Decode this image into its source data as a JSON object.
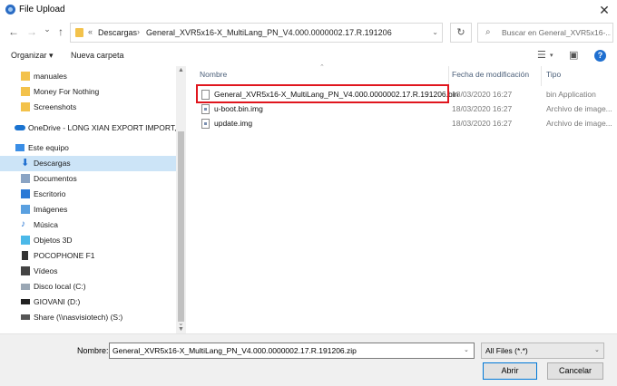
{
  "window": {
    "title": "File Upload",
    "close_glyph": "✕"
  },
  "nav": {
    "back": "←",
    "forward": "→",
    "recent": "⌄",
    "up": "↑"
  },
  "address": {
    "prefix": "«",
    "crumbs": [
      "Descargas",
      "General_XVR5x16-X_MultiLang_PN_V4.000.0000002.17.R.191206"
    ],
    "separator": "›"
  },
  "search": {
    "placeholder": "Buscar en General_XVR5x16-..."
  },
  "toolbar": {
    "organize": "Organizar ▾",
    "new_folder": "Nueva carpeta"
  },
  "sidebar": {
    "items": [
      {
        "label": "manuales",
        "icon": "folder-icon"
      },
      {
        "label": "Money For Nothing",
        "icon": "folder-icon"
      },
      {
        "label": "Screenshots",
        "icon": "folder-icon"
      },
      {
        "label": "OneDrive - LONG XIAN EXPORT IMPORT, SI",
        "icon": "onedrive-icon"
      },
      {
        "label": "Este equipo",
        "icon": "computer-icon"
      },
      {
        "label": "Descargas",
        "icon": "downloads-icon",
        "selected": true
      },
      {
        "label": "Documentos",
        "icon": "documents-icon"
      },
      {
        "label": "Escritorio",
        "icon": "desktop-icon"
      },
      {
        "label": "Imágenes",
        "icon": "pictures-icon"
      },
      {
        "label": "Música",
        "icon": "music-icon"
      },
      {
        "label": "Objetos 3D",
        "icon": "objects-3d-icon"
      },
      {
        "label": "POCOPHONE F1",
        "icon": "phone-icon"
      },
      {
        "label": "Vídeos",
        "icon": "videos-icon"
      },
      {
        "label": "Disco local (C:)",
        "icon": "drive-icon"
      },
      {
        "label": "GIOVANI (D:)",
        "icon": "drive-icon"
      },
      {
        "label": "Share (\\\\nasvisiotech) (S:)",
        "icon": "network-drive-icon"
      }
    ]
  },
  "columns": {
    "name": "Nombre",
    "date": "Fecha de modificación",
    "type": "Tipo"
  },
  "files": [
    {
      "name": "General_XVR5x16-X_MultiLang_PN_V4.000.0000002.17.R.191206.bin",
      "date": "18/03/2020 16:27",
      "type": "bin Application"
    },
    {
      "name": "u-boot.bin.img",
      "date": "18/03/2020 16:27",
      "type": "Archivo de image..."
    },
    {
      "name": "update.img",
      "date": "18/03/2020 16:27",
      "type": "Archivo de image..."
    }
  ],
  "footer": {
    "name_label": "Nombre:",
    "name_value": "General_XVR5x16-X_MultiLang_PN_V4.000.0000002.17.R.191206.zip",
    "filter": "All Files (*.*)",
    "open": "Abrir",
    "cancel": "Cancelar"
  },
  "colors": {
    "highlight": "#e0161e",
    "selection": "#cce4f7",
    "accent": "#0078d7"
  }
}
